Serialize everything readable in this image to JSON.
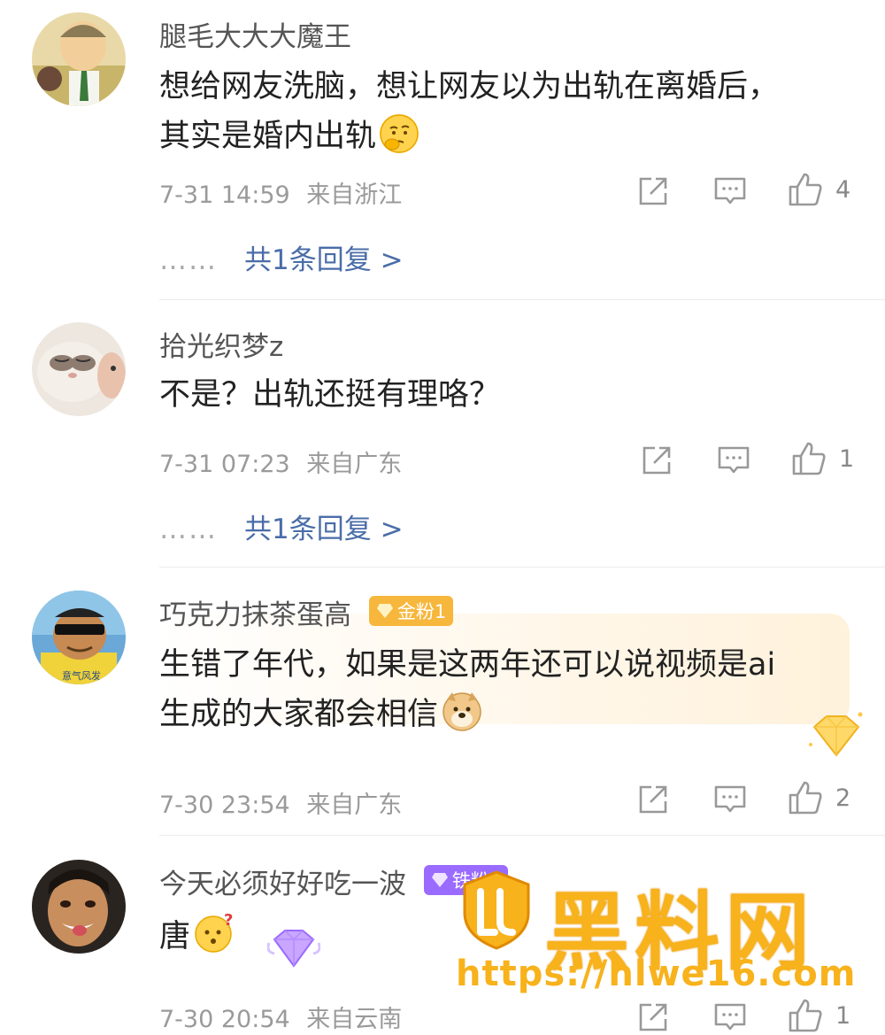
{
  "comments": [
    {
      "username": "腿毛大大大魔王",
      "content_line1": "想给网友洗脑，想让网友以为出轨在离婚后，",
      "content_line2": "其实是婚内出轨",
      "emoji": "thinking-emoji",
      "time": "7-31 14:59",
      "location": "来自浙江",
      "likes": "4",
      "reply_text": "共1条回复 >"
    },
    {
      "username": "拾光织梦z",
      "content_line1": "不是？出轨还挺有理咯？",
      "time": "7-31 07:23",
      "location": "来自广东",
      "likes": "1",
      "reply_text": "共1条回复 >"
    },
    {
      "username": "巧克力抹茶蛋高",
      "badge": "金粉1",
      "content_line1": "生错了年代，如果是这两年还可以说视频是ai",
      "content_line2": "生成的大家都会相信",
      "emoji": "doge-emoji",
      "time": "7-30 23:54",
      "location": "来自广东",
      "likes": "2"
    },
    {
      "username": "今天必须好好吃一波",
      "badge": "铁粉3",
      "content_line1": "唐",
      "emoji": "confused-emoji",
      "time": "7-30 20:54",
      "location": "来自云南",
      "likes": "1"
    }
  ],
  "reply_dots": "……",
  "watermark": {
    "title": "黑料网",
    "url": "https://hlwe16.com"
  },
  "colors": {
    "link": "#4a6da8",
    "meta": "#9a9a9a",
    "gold_badge": "#f6b73c",
    "purple_badge": "#9a6bff",
    "watermark": "#f7b21c"
  }
}
